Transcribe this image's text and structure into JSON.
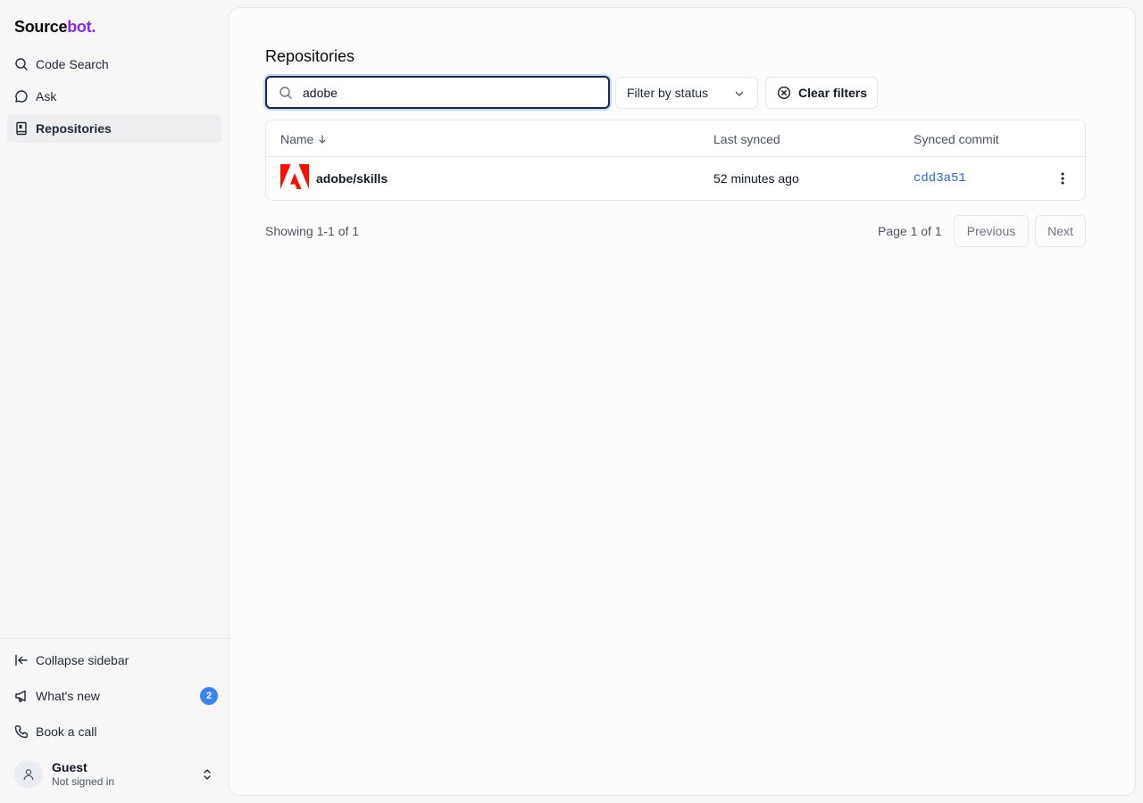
{
  "app": {
    "logo_main": "Source",
    "logo_accent": "bot.",
    "accent_color": "#8b2be2"
  },
  "sidebar": {
    "items": [
      {
        "label": "Code Search",
        "icon": "search-icon"
      },
      {
        "label": "Ask",
        "icon": "chat-bubble-icon"
      },
      {
        "label": "Repositories",
        "icon": "book-icon",
        "active": true
      }
    ],
    "footer": [
      {
        "label": "Collapse sidebar",
        "icon": "collapse-left-icon"
      },
      {
        "label": "What's new",
        "icon": "megaphone-icon",
        "badge": "2"
      },
      {
        "label": "Book a call",
        "icon": "phone-icon"
      }
    ],
    "user": {
      "name": "Guest",
      "status": "Not signed in"
    }
  },
  "main": {
    "title": "Repositories",
    "search": {
      "value": "adobe",
      "placeholder": ""
    },
    "filter_label": "Filter by status",
    "clear_label": "Clear filters",
    "table": {
      "columns": [
        "Name",
        "Last synced",
        "Synced commit"
      ],
      "name_sort_icon": "arrow-down-icon",
      "rows": [
        {
          "name": "adobe/skills",
          "last_synced": "52 minutes ago",
          "commit": "cdd3a51",
          "icon": "adobe-logo-icon"
        }
      ]
    },
    "pagination": {
      "showing": "Showing 1-1 of 1",
      "page": "Page 1 of 1",
      "previous": "Previous",
      "next": "Next"
    }
  }
}
